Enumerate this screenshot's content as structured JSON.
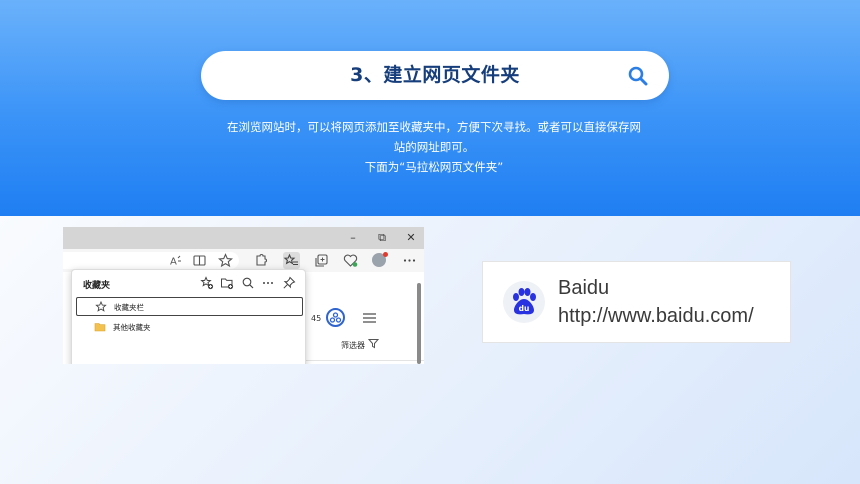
{
  "banner": {
    "title": "3、建立网页文件夹",
    "description_lines": [
      "在浏览网站时，可以将网页添加至收藏夹中，方便下次寻找。或者可以直接保存网",
      "站的网址即可。",
      "下面为“马拉松网页文件夹”"
    ]
  },
  "browser": {
    "window_controls": {
      "minimize": "–",
      "restore": "⧉",
      "close": "✕"
    },
    "favorites_panel": {
      "header": "收藏夹",
      "items": [
        {
          "label": "收藏夹栏",
          "icon": "star-icon"
        },
        {
          "label": "其他收藏夹",
          "icon": "folder-icon"
        }
      ]
    },
    "count": "45",
    "filter_label": "筛选器"
  },
  "baidu": {
    "name": "Baidu",
    "url": "http://www.baidu.com/"
  },
  "colors": {
    "banner_top": "#6ab1fb",
    "banner_bottom": "#1f7ef2",
    "title_text": "#173e7c",
    "search_icon": "#2a7ee6",
    "baidu_blue": "#2932e1"
  }
}
